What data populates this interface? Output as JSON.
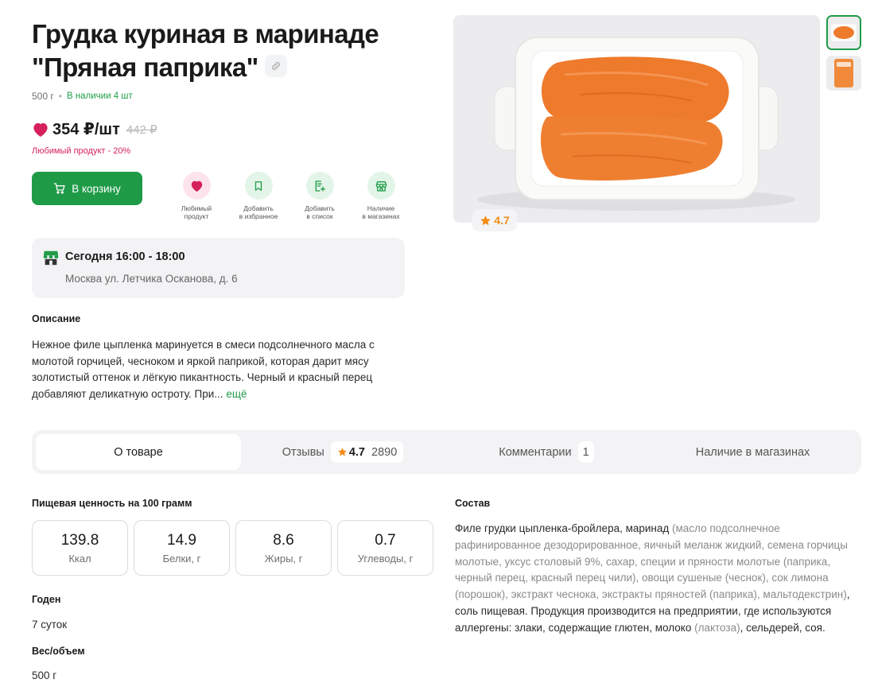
{
  "product": {
    "title": "Грудка куриная в маринаде \"Пряная паприка\"",
    "weight": "500 г",
    "stock": "В наличии 4 шт",
    "price": "354 ₽/шт",
    "old_price": "442 ₽",
    "favorite_note": "Любимый продукт - 20%",
    "rating": "4.7"
  },
  "actions": {
    "cart_label": "В корзину",
    "items": [
      {
        "label": "Любимый\nпродукт",
        "icon": "heart-icon"
      },
      {
        "label": "Добавить\nв избранное",
        "icon": "bookmark-icon"
      },
      {
        "label": "Добавить\nв список",
        "icon": "list-add-icon"
      },
      {
        "label": "Наличие\nв магазинах",
        "icon": "store-icon"
      }
    ]
  },
  "delivery": {
    "title": "Сегодня 16:00 - 18:00",
    "address": "Москва ул. Летчика Осканова, д. 6",
    "icon": "store-front-icon"
  },
  "description": {
    "heading": "Описание",
    "text": "Нежное филе цыпленка маринуется в смеси подсолнечного масла с молотой горчицей, чесноком и яркой паприкой, которая дарит мясу золотистый оттенок и лёгкую пикантность. Черный и красный перец добавляют деликатную остроту. При...",
    "more": "ещё"
  },
  "tabs": {
    "about": "О товаре",
    "reviews": "Отзывы",
    "reviews_rating": "4.7",
    "reviews_count": "2890",
    "comments": "Комментарии",
    "comments_count": "1",
    "availability": "Наличие в магазинах"
  },
  "nutrition": {
    "heading": "Пищевая ценность на 100 грамм",
    "items": [
      {
        "value": "139.8",
        "unit": "Ккал"
      },
      {
        "value": "14.9",
        "unit": "Белки, г"
      },
      {
        "value": "8.6",
        "unit": "Жиры, г"
      },
      {
        "value": "0.7",
        "unit": "Углеводы, г"
      }
    ]
  },
  "shelf_life": {
    "heading": "Годен",
    "value": "7 суток"
  },
  "volume": {
    "heading": "Вес/объем",
    "value": "500 г"
  },
  "composition": {
    "heading": "Состав",
    "part1": "Филе грудки цыпленка-бройлера, маринад ",
    "part2": "(масло подсолнечное рафинированное дезодорированное, яичный меланж жидкий, семена горчицы молотые, уксус столовый 9%, сахар, специи и пряности молотые (паприка, черный перец, красный перец чили), овощи сушеные (чеснок), сок лимона (порошок), экстракт чеснока, экстракты пряностей (паприка), мальтодекстрин)",
    "part3": ", соль пищевая. Продукция производится на предприятии, где используются аллергены: злаки, содержащие глютен, молоко ",
    "part4": "(лактоза)",
    "part5": ", сельдерей, соя."
  },
  "colors": {
    "brand_green": "#1f9b48",
    "favorite_pink": "#d6225c",
    "rating_orange": "#f28c16"
  }
}
